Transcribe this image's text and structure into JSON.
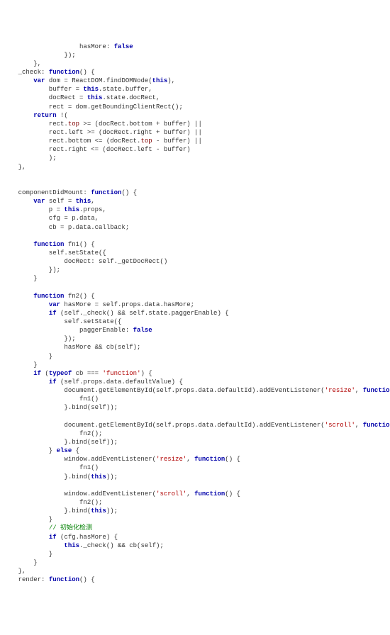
{
  "code": {
    "tokens": [
      "                    hasMore: ",
      [
        "bool",
        "false"
      ],
      "\n",
      "                });\n",
      "        },\n",
      "    _check: ",
      [
        "kw",
        "function"
      ],
      "() {\n",
      "        ",
      [
        "kw",
        "var"
      ],
      " dom = ReactDOM.findDOMNode(",
      [
        "kw",
        "this"
      ],
      "),\n",
      "            buffer = ",
      [
        "kw",
        "this"
      ],
      ".state.buffer,\n",
      "            docRect = ",
      [
        "kw",
        "this"
      ],
      ".state.docRect,\n",
      "            rect = dom.getBoundingClientRect();\n",
      "        ",
      [
        "kw",
        "return"
      ],
      " !(\n",
      "            rect.",
      [
        "prop",
        "top"
      ],
      " >= (docRect.bottom + buffer) ||\n",
      "            rect.left >= (docRect.right + buffer) ||\n",
      "            rect.bottom <= (docRect.",
      [
        "prop",
        "top"
      ],
      " - buffer) ||\n",
      "            rect.right <= (docRect.left - buffer)\n",
      "            );\n",
      "    },\n",
      "\n",
      "\n",
      "    componentDidMount: ",
      [
        "kw",
        "function"
      ],
      "() {\n",
      "        ",
      [
        "kw",
        "var"
      ],
      " self = ",
      [
        "kw",
        "this"
      ],
      ",\n",
      "            p = ",
      [
        "kw",
        "this"
      ],
      ".props,\n",
      "            cfg = p.data,\n",
      "            cb = p.data.callback;\n",
      "\n",
      "        ",
      [
        "kw",
        "function"
      ],
      " fn1() {\n",
      "            self.setState({\n",
      "                docRect: self._getDocRect()\n",
      "            });\n",
      "        }\n",
      "\n",
      "        ",
      [
        "kw",
        "function"
      ],
      " fn2() {\n",
      "            ",
      [
        "kw",
        "var"
      ],
      " hasMore = self.props.data.hasMore;\n",
      "            ",
      [
        "kw",
        "if"
      ],
      " (self._check() && self.state.paggerEnable) {\n",
      "                self.setState({\n",
      "                    paggerEnable: ",
      [
        "bool",
        "false"
      ],
      "\n",
      "                });\n",
      "                hasMore && cb(self);\n",
      "            }\n",
      "        }\n",
      "        ",
      [
        "kw",
        "if"
      ],
      " (",
      [
        "kw",
        "typeof"
      ],
      " cb === ",
      [
        "str",
        "'function'"
      ],
      ") {\n",
      "            ",
      [
        "kw",
        "if"
      ],
      " (self.props.data.defaultValue) {\n",
      "                document.getElementById(self.props.data.defaultId).addEventListener(",
      [
        "str",
        "'resize'"
      ],
      ", ",
      [
        "kw",
        "function"
      ],
      "() {\n",
      "                    fn1()\n",
      "                }.bind(self));\n",
      "\n",
      "                document.getElementById(self.props.data.defaultId).addEventListener(",
      [
        "str",
        "'scroll'"
      ],
      ", ",
      [
        "kw",
        "function"
      ],
      "() {\n",
      "                    fn2();\n",
      "                }.bind(self));\n",
      "            } ",
      [
        "kw",
        "else"
      ],
      " {\n",
      "                window.addEventListener(",
      [
        "str",
        "'resize'"
      ],
      ", ",
      [
        "kw",
        "function"
      ],
      "() {\n",
      "                    fn1()\n",
      "                }.bind(",
      [
        "kw",
        "this"
      ],
      "));\n",
      "\n",
      "                window.addEventListener(",
      [
        "str",
        "'scroll'"
      ],
      ", ",
      [
        "kw",
        "function"
      ],
      "() {\n",
      "                    fn2();\n",
      "                }.bind(",
      [
        "kw",
        "this"
      ],
      "));\n",
      "            }\n",
      "            ",
      [
        "com",
        "// 初始化检测"
      ],
      "\n",
      "            ",
      [
        "kw",
        "if"
      ],
      " (cfg.hasMore) {\n",
      "                ",
      [
        "kw",
        "this"
      ],
      "._check() && cb(self);\n",
      "            }\n",
      "        }\n",
      "    },\n",
      "    render: ",
      [
        "kw",
        "function"
      ],
      "() {\n"
    ]
  }
}
